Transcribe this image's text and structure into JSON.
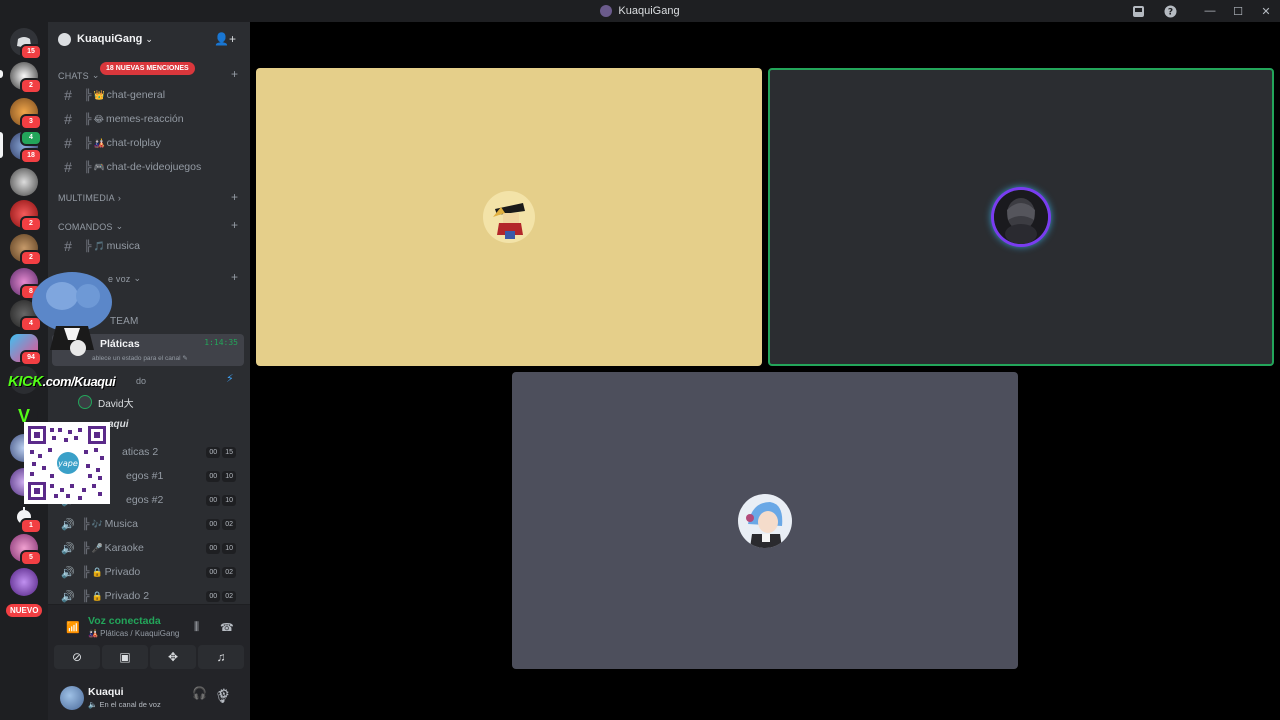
{
  "window": {
    "title": "KuaquiGang"
  },
  "server_rail": {
    "badges": [
      "15",
      "2",
      "3",
      "4",
      "18",
      "2",
      "2",
      "8",
      "4",
      "94",
      "1",
      "5"
    ],
    "new_label": "NUEVO"
  },
  "guild": {
    "name": "KuaquiGang",
    "mentions_badge": "18 NUEVAS MENCIONES"
  },
  "categories": {
    "chats": "CHATS",
    "multimedia": "MULTIMEDIA",
    "comandos": "COMANDOS",
    "voz": "e voz",
    "team": "TEAM"
  },
  "text_channels": [
    {
      "name": "chat-general",
      "emoji": "👑"
    },
    {
      "name": "memes-reacción",
      "emoji": "😂"
    },
    {
      "name": "chat-rolplay",
      "emoji": "🎎"
    },
    {
      "name": "chat-de-videojuegos",
      "emoji": "🎮"
    }
  ],
  "command_channels": [
    {
      "name": "musica",
      "emoji": "🎵"
    }
  ],
  "active_voice": {
    "name": "Pláticas",
    "timer": "1:14:35",
    "status": "ablece un estado para el canal"
  },
  "voice_users": [
    {
      "name": "do"
    },
    {
      "name": "David大"
    },
    {
      "name": "aqui"
    }
  ],
  "voice_channels": [
    {
      "name": "aticas 2",
      "count_a": "00",
      "count_b": "15"
    },
    {
      "name": "egos #1",
      "count_a": "00",
      "count_b": "10"
    },
    {
      "name": "egos #2",
      "count_a": "00",
      "count_b": "10"
    },
    {
      "name": "Musica",
      "emoji": "🎶",
      "count_a": "00",
      "count_b": "02"
    },
    {
      "name": "Karaoke",
      "emoji": "🎤",
      "count_a": "00",
      "count_b": "10"
    },
    {
      "name": "Privado",
      "emoji": "🔒",
      "count_a": "00",
      "count_b": "02"
    },
    {
      "name": "Privado 2",
      "emoji": "🔒",
      "count_a": "00",
      "count_b": "02"
    }
  ],
  "overlay": {
    "kick_brand": "KICK",
    "kick_url": ".com/Kuaqui"
  },
  "voice_panel": {
    "title": "Voz conectada",
    "subtitle": "🎎 Pláticas / KuaquiGang"
  },
  "user": {
    "name": "Kuaqui",
    "status": "En el canal de voz"
  },
  "colors": {
    "tile1_bg": "#e5cf8a",
    "tile2_bg": "#2b2d31",
    "tile3_bg": "#4d4f5c",
    "speaking_border": "#23a55a"
  }
}
